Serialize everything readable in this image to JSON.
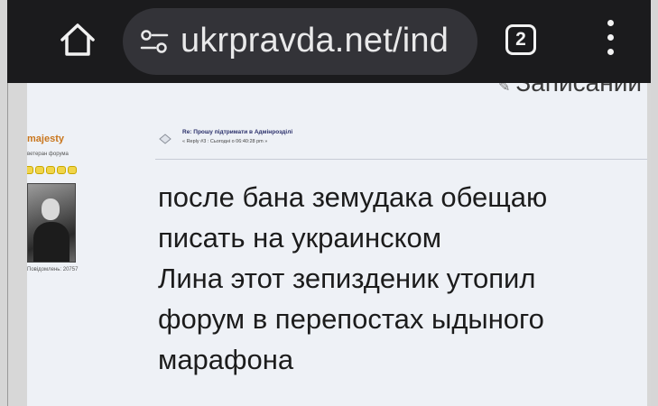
{
  "browser": {
    "url": "ukrpravda.net/ind",
    "tab_count": "2",
    "icons": [
      "home-icon",
      "tune-icon",
      "tab-switcher-icon",
      "more-vert-icon"
    ]
  },
  "page": {
    "top_partial_text": "Записаний",
    "user": {
      "name": "majesty",
      "rank": "ветеран форума",
      "posts_label": "Повідомлень: 20757"
    },
    "post": {
      "title": "Re: Прошу підтримати в Адмінрозділі",
      "meta": "« Reply #3 : Сьогодні о 06:40:28 pm »",
      "body_lines": [
        "после бана земудака обещаю",
        "писать на украинском",
        "Лина этот зепизденик утопил",
        "форум в перепостах ыдыного",
        "марафона"
      ]
    }
  },
  "colors": {
    "toolbar_bg": "#1b1b1d",
    "url_pill_bg": "#333338",
    "page_bg": "#eef1f6",
    "username_color": "#c9761d",
    "title_color": "#2a2f6a"
  }
}
